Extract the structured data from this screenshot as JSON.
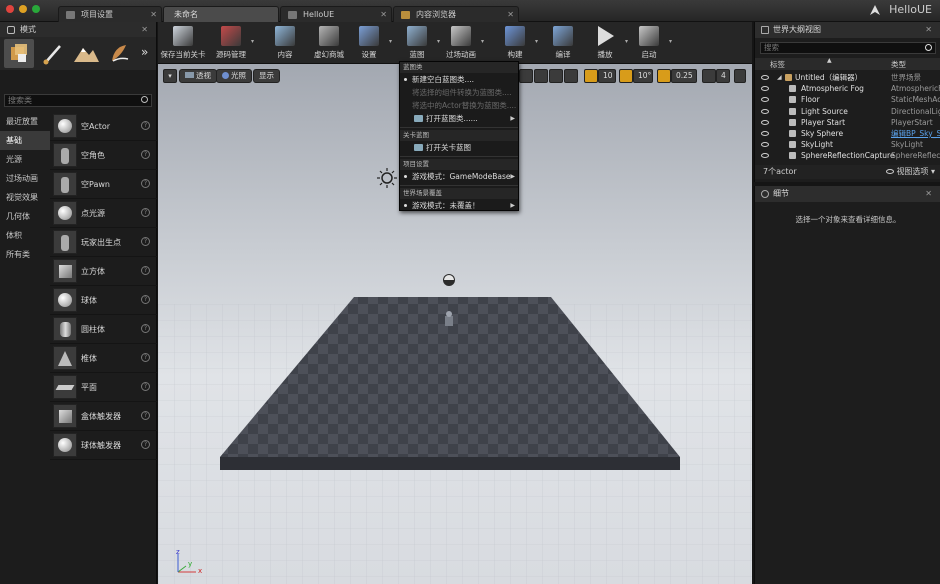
{
  "window": {
    "app_title": "HelloUE",
    "tabs": [
      {
        "label": "项目设置",
        "active": false
      },
      {
        "label": "未命名",
        "active": true
      },
      {
        "label": "HelloUE",
        "active": false
      },
      {
        "label": "内容浏览器",
        "active": false
      }
    ]
  },
  "modes": {
    "title": "模式",
    "search_placeholder": "搜索类",
    "categories": [
      "最近放置",
      "基础",
      "光源",
      "过场动画",
      "视觉效果",
      "几何体",
      "体积",
      "所有类"
    ],
    "selected_category": "基础",
    "placeables": [
      "空Actor",
      "空角色",
      "空Pawn",
      "点光源",
      "玩家出生点",
      "立方体",
      "球体",
      "圆柱体",
      "椎体",
      "平面",
      "盒体触发器",
      "球体触发器"
    ],
    "help_glyph": "?"
  },
  "toolbar": {
    "items": [
      {
        "label": "保存当前关卡",
        "icon": "save-icon",
        "color": "#cfd6de"
      },
      {
        "label": "源码管理",
        "icon": "source-control-icon",
        "color": "#c44a4a"
      },
      {
        "label": "内容",
        "icon": "content-icon",
        "color": "#8fb6d9"
      },
      {
        "label": "虚幻商城",
        "icon": "marketplace-icon",
        "color": "#b5b5b5"
      },
      {
        "label": "设置",
        "icon": "settings-icon",
        "color": "#7b9fd6"
      },
      {
        "label": "蓝图",
        "icon": "blueprint-icon",
        "color": "#8fb0d0"
      },
      {
        "label": "过场动画",
        "icon": "cinematics-icon",
        "color": "#c8c8c8"
      },
      {
        "label": "构建",
        "icon": "build-icon",
        "color": "#6d95d8"
      },
      {
        "label": "编译",
        "icon": "compile-icon",
        "color": "#7ea6d8"
      },
      {
        "label": "播放",
        "icon": "play-icon",
        "color": "#d5d5d5"
      },
      {
        "label": "启动",
        "icon": "launch-icon",
        "color": "#c8c8c8"
      }
    ]
  },
  "viewport": {
    "perspective_label": "透视",
    "lit_label": "光照",
    "show_label": "显示",
    "grid_snap": "10",
    "rot_snap": "10°",
    "scale_snap": "0.25",
    "camera_speed": "4",
    "accent_color": "#e2a21a",
    "axis_x": "x",
    "axis_y": "y",
    "axis_z": "z"
  },
  "blueprint_menu": {
    "sections": [
      {
        "header": "蓝图类",
        "items": [
          {
            "label": "新建空白蓝图类....",
            "disabled": false,
            "bullet": true,
            "icon": false,
            "submenu": false
          },
          {
            "label": "将选择的组件转换为蓝图类....",
            "disabled": true,
            "bullet": false,
            "icon": false,
            "submenu": false
          },
          {
            "label": "将选中的Actor替换为蓝图类....",
            "disabled": true,
            "bullet": false,
            "icon": false,
            "submenu": false
          },
          {
            "label": "打开蓝图类......",
            "disabled": false,
            "bullet": false,
            "icon": true,
            "submenu": true
          }
        ]
      },
      {
        "header": "关卡蓝图",
        "items": [
          {
            "label": "打开关卡蓝图",
            "disabled": false,
            "bullet": false,
            "icon": true,
            "submenu": false
          }
        ]
      },
      {
        "header": "项目设置",
        "items": [
          {
            "label": "游戏模式：GameModeBase",
            "disabled": false,
            "bullet": true,
            "icon": false,
            "submenu": true
          }
        ]
      },
      {
        "header": "世界场景覆盖",
        "items": [
          {
            "label": "游戏模式：未覆盖！",
            "disabled": false,
            "bullet": true,
            "icon": false,
            "submenu": true
          }
        ]
      }
    ]
  },
  "outliner": {
    "title": "世界大纲视图",
    "search_placeholder": "搜索",
    "col_label": "标签",
    "col_type": "类型",
    "rows": [
      {
        "name": "Untitled（编辑器）",
        "type": "世界场景",
        "root": true
      },
      {
        "name": "Atmospheric Fog",
        "type": "AtmosphericFog",
        "root": false
      },
      {
        "name": "Floor",
        "type": "StaticMeshActor",
        "root": false
      },
      {
        "name": "Light Source",
        "type": "DirectionalLight",
        "root": false
      },
      {
        "name": "Player Start",
        "type": "PlayerStart",
        "root": false
      },
      {
        "name": "Sky Sphere",
        "type": "编辑BP_Sky_Sphere",
        "root": false,
        "link": true
      },
      {
        "name": "SkyLight",
        "type": "SkyLight",
        "root": false
      },
      {
        "name": "SphereReflectionCapture",
        "type": "SphereReflectionCapture",
        "root": false
      }
    ],
    "actor_count": "7个actor",
    "view_options": "视图选项"
  },
  "details": {
    "title": "细节",
    "empty_text": "选择一个对象来查看详细信息。"
  }
}
